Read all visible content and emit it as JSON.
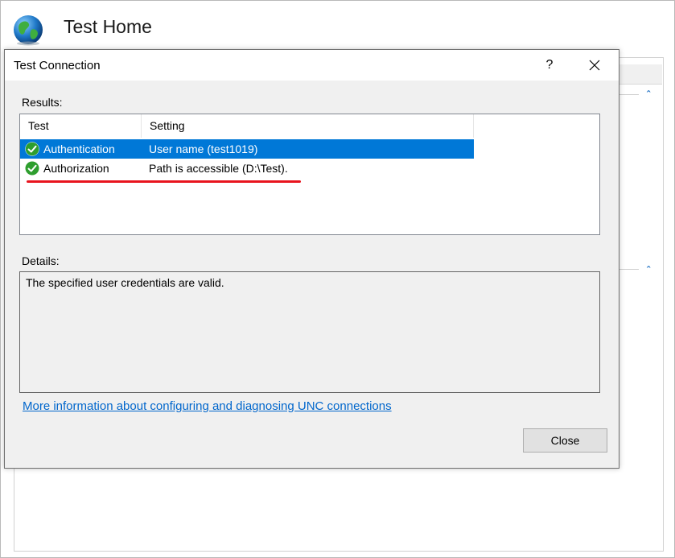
{
  "background_window": {
    "title": "Test Home"
  },
  "dialog": {
    "title": "Test Connection",
    "help_glyph": "?",
    "results_label": "Results:",
    "columns": {
      "test": "Test",
      "setting": "Setting"
    },
    "rows": [
      {
        "test": "Authentication",
        "setting": "User name (test1019)",
        "status": "success",
        "selected": true
      },
      {
        "test": "Authorization",
        "setting": "Path is accessible (D:\\Test).",
        "status": "success",
        "selected": false
      }
    ],
    "details_label": "Details:",
    "details_text": "The specified user credentials are valid.",
    "more_info_link": "More information about configuring and diagnosing UNC connections",
    "close_button": "Close"
  },
  "colors": {
    "selection": "#0078d7",
    "link": "#0066cc",
    "success_green": "#2e9e2e",
    "annotation_red": "#e8141e"
  },
  "icons": [
    "globe-icon",
    "help-icon",
    "close-icon",
    "success-check-icon",
    "chevron-up-icon"
  ]
}
